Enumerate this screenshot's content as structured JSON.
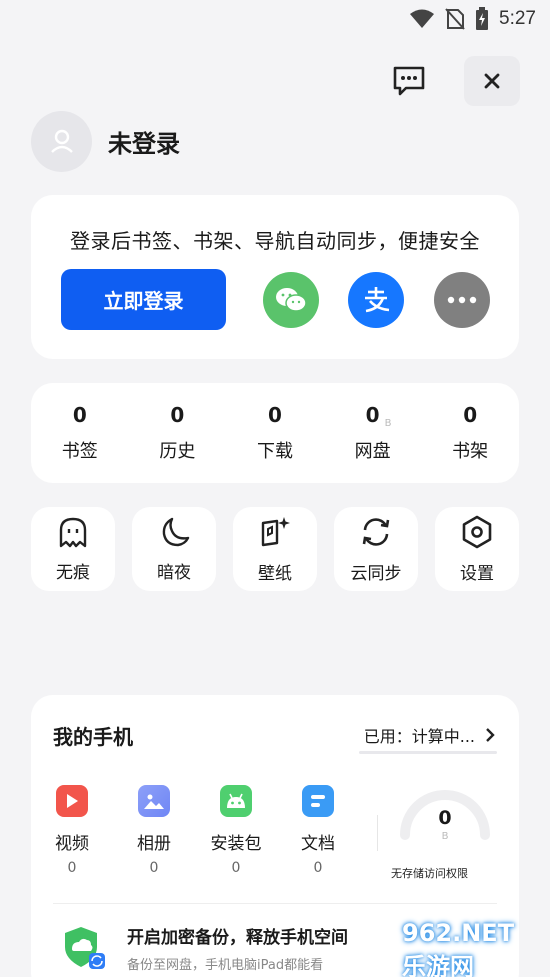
{
  "status_bar": {
    "time": "5:27"
  },
  "profile": {
    "name": "未登录"
  },
  "login_card": {
    "tip": "登录后书签、书架、导航自动同步，便捷安全",
    "login_button": "立即登录",
    "social": [
      {
        "icon": "wechat-icon",
        "color": "#5ac36b"
      },
      {
        "icon": "alipay-icon",
        "color": "#1677ff"
      },
      {
        "icon": "more-icon",
        "color": "#808080"
      }
    ]
  },
  "stats": [
    {
      "value": "0",
      "label": "书签",
      "unit": ""
    },
    {
      "value": "0",
      "label": "历史",
      "unit": ""
    },
    {
      "value": "0",
      "label": "下载",
      "unit": ""
    },
    {
      "value": "0",
      "label": "网盘",
      "unit": "B"
    },
    {
      "value": "0",
      "label": "书架",
      "unit": ""
    }
  ],
  "tools": [
    {
      "label": "无痕",
      "icon": "ghost-icon"
    },
    {
      "label": "暗夜",
      "icon": "moon-icon"
    },
    {
      "label": "壁纸",
      "icon": "wallpaper-icon"
    },
    {
      "label": "云同步",
      "icon": "sync-icon"
    },
    {
      "label": "设置",
      "icon": "settings-hexagon-icon"
    }
  ],
  "my_phone": {
    "title": "我的手机",
    "used": "已用：计算中...",
    "categories": [
      {
        "label": "视频",
        "count": "0",
        "icon": "video-icon",
        "color": "#f2554b"
      },
      {
        "label": "相册",
        "count": "0",
        "icon": "photo-icon",
        "color": "#6f86f5"
      },
      {
        "label": "安装包",
        "count": "0",
        "icon": "android-icon",
        "color": "#4fcf6f"
      },
      {
        "label": "文档",
        "count": "0",
        "icon": "doc-icon",
        "color": "#3a9bf5"
      }
    ],
    "gauge_value": "0",
    "gauge_unit": "B",
    "no_access": "无存储访问权限",
    "backup_title": "开启加密备份，释放手机空间",
    "backup_sub": "备份至网盘，手机电脑iPad都能看"
  },
  "watermark": "962.NET 乐游网"
}
